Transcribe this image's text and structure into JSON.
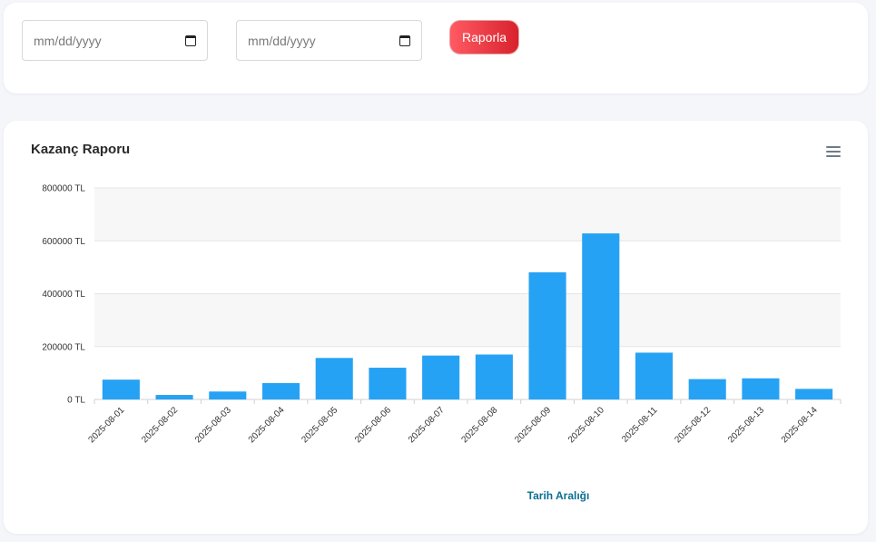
{
  "filters": {
    "start_date_placeholder": "mm/dd/yyyy",
    "end_date_placeholder": "mm/dd/yyyy",
    "report_button_label": "Raporla"
  },
  "chart_card": {
    "title": "Kazanç Raporu",
    "menu_icon": "hamburger-menu-icon"
  },
  "colors": {
    "bar": "#26a2f4",
    "button_start": "#ff5a63",
    "button_end": "#d8222d",
    "axis_title": "#0b6f94"
  },
  "chart_data": {
    "type": "bar",
    "title": "Kazanç Raporu",
    "xlabel": "Tarih Aralığı",
    "ylabel": "",
    "ylim": [
      0,
      800000
    ],
    "yticks": [
      0,
      200000,
      400000,
      600000,
      800000
    ],
    "ytick_labels": [
      "0 TL",
      "200000 TL",
      "400000 TL",
      "600000 TL",
      "800000 TL"
    ],
    "categories": [
      "2025-08-01",
      "2025-08-02",
      "2025-08-03",
      "2025-08-04",
      "2025-08-05",
      "2025-08-06",
      "2025-08-07",
      "2025-08-08",
      "2025-08-09",
      "2025-08-10",
      "2025-08-11",
      "2025-08-12",
      "2025-08-13",
      "2025-08-14"
    ],
    "values": [
      75000,
      17000,
      30000,
      62000,
      157000,
      120000,
      166000,
      170000,
      481000,
      628000,
      177000,
      77000,
      80000,
      40000
    ],
    "grid": true
  }
}
